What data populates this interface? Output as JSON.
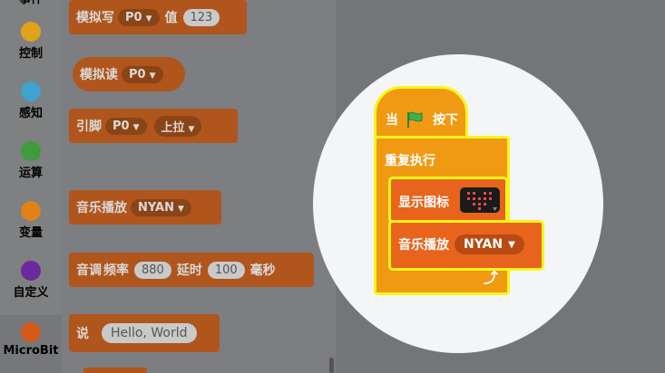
{
  "categories": [
    {
      "label": "事件",
      "color": "#d9a400"
    },
    {
      "label": "控制",
      "color": "#e0a21a"
    },
    {
      "label": "感知",
      "color": "#3ea3cf"
    },
    {
      "label": "运算",
      "color": "#3f9b3c"
    },
    {
      "label": "变量",
      "color": "#e08218"
    },
    {
      "label": "自定义",
      "color": "#6b2a9c"
    },
    {
      "label": "MicroBit",
      "color": "#d45a1a"
    }
  ],
  "palette": {
    "analog_write": {
      "label": "模拟写",
      "pin": "P0",
      "value_label": "值",
      "value": "123"
    },
    "analog_read": {
      "label": "模拟读",
      "pin": "P0"
    },
    "pin_pull": {
      "label": "引脚",
      "pin": "P0",
      "mode": "上拉"
    },
    "play_music": {
      "label": "音乐播放",
      "melody": "NYAN"
    },
    "tone": {
      "label": "音调",
      "freq_label": "频率",
      "freq": "880",
      "delay_label": "延时",
      "delay": "100",
      "unit": "毫秒"
    },
    "say": {
      "label": "说",
      "text": "Hello, World"
    }
  },
  "script": {
    "hat": {
      "label_before": "当",
      "label_after": "按下",
      "flag_color": "#3bb54a"
    },
    "forever": {
      "label": "重复执行"
    },
    "show_icon": {
      "label": "显示图标"
    },
    "play_music": {
      "label": "音乐播放",
      "melody": "NYAN"
    }
  }
}
